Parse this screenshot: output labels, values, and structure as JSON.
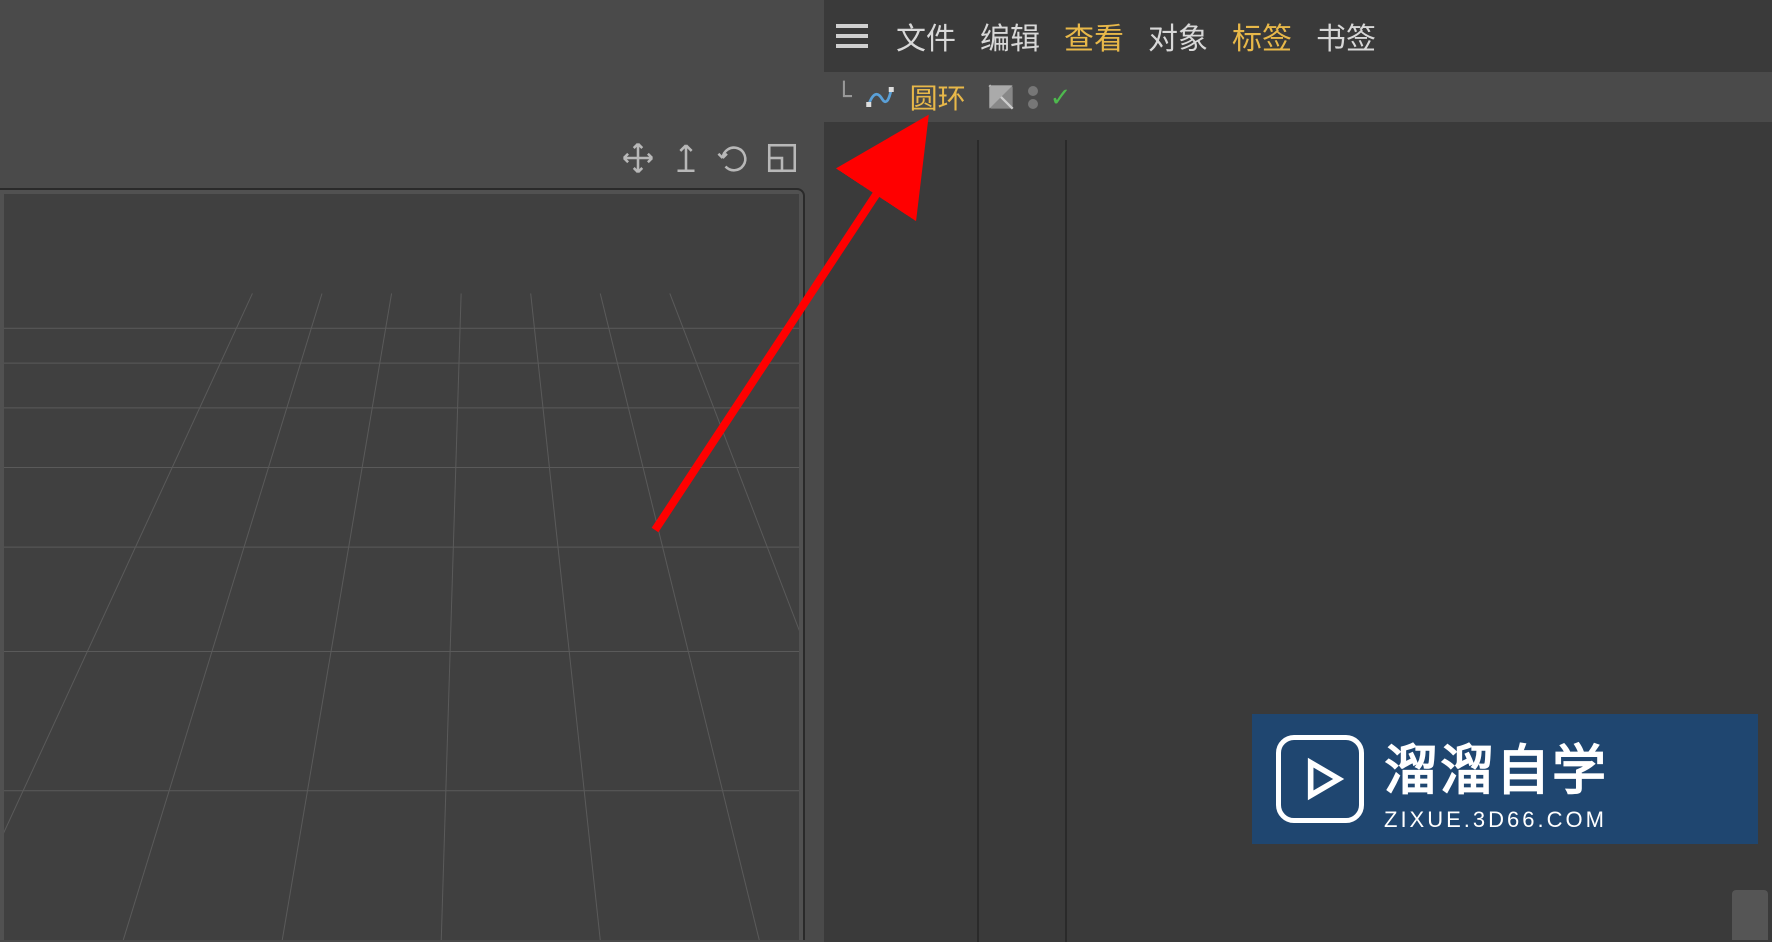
{
  "panel": {
    "menu": {
      "file": "文件",
      "edit": "编辑",
      "view": "查看",
      "object": "对象",
      "tags": "标签",
      "bookmarks": "书签"
    },
    "object_tree": {
      "item_label": "圆环",
      "spline_icon": "spline-icon",
      "tag_icon": "layer-tag-icon"
    }
  },
  "viewport": {
    "tools": {
      "move": "move-icon",
      "scale": "scale-icon",
      "rotate": "rotate-icon",
      "frame": "frame-icon"
    }
  },
  "watermark": {
    "title": "溜溜自学",
    "subtitle": "ZIXUE.3D66.COM"
  }
}
